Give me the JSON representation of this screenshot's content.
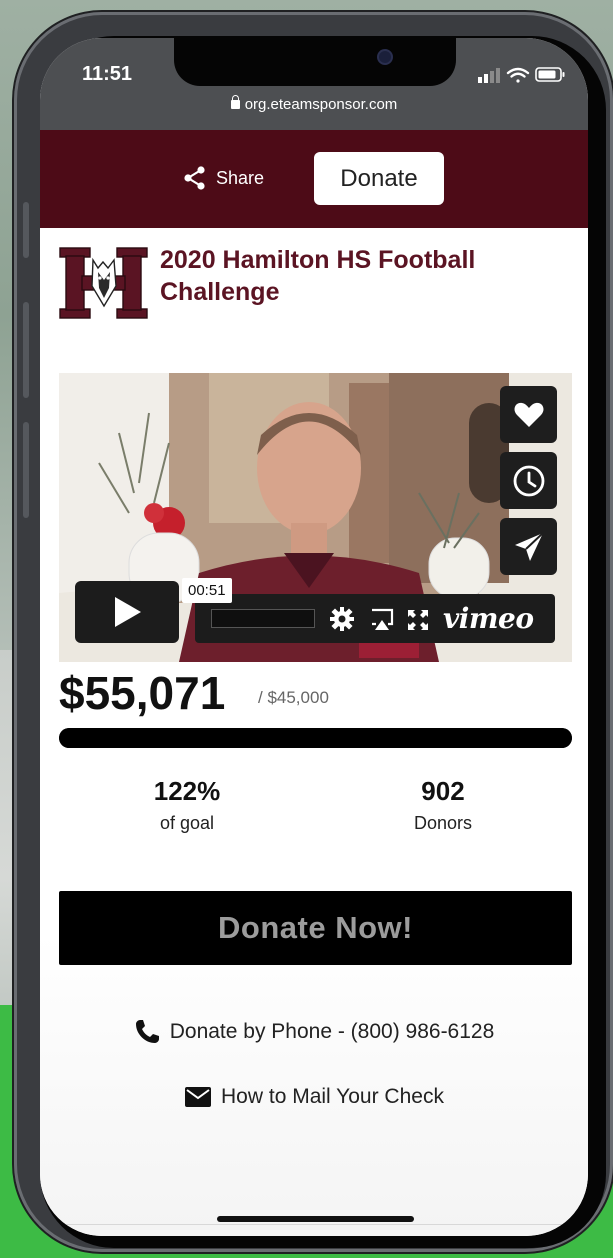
{
  "status_bar": {
    "time": "11:51",
    "url": "org.eteamsponsor.com"
  },
  "header": {
    "share_label": "Share",
    "donate_label": "Donate",
    "bar_color": "#4d0b17"
  },
  "campaign": {
    "title": "2020 Hamilton HS Football Challenge",
    "logo_letter": "H"
  },
  "video": {
    "timestamp": "00:51",
    "provider": "vimeo",
    "side_actions": [
      "heart-icon",
      "clock-icon",
      "send-icon"
    ]
  },
  "fundraising": {
    "raised": "$55,071",
    "goal": "/ $45,000",
    "progress_fraction": 1.0,
    "stats": [
      {
        "value": "122%",
        "label": "of goal"
      },
      {
        "value": "902",
        "label": "Donors"
      }
    ]
  },
  "actions": {
    "donate_now": "Donate Now!",
    "phone": "Donate by Phone - (800) 986-6128",
    "mail": "How to Mail Your Check"
  }
}
